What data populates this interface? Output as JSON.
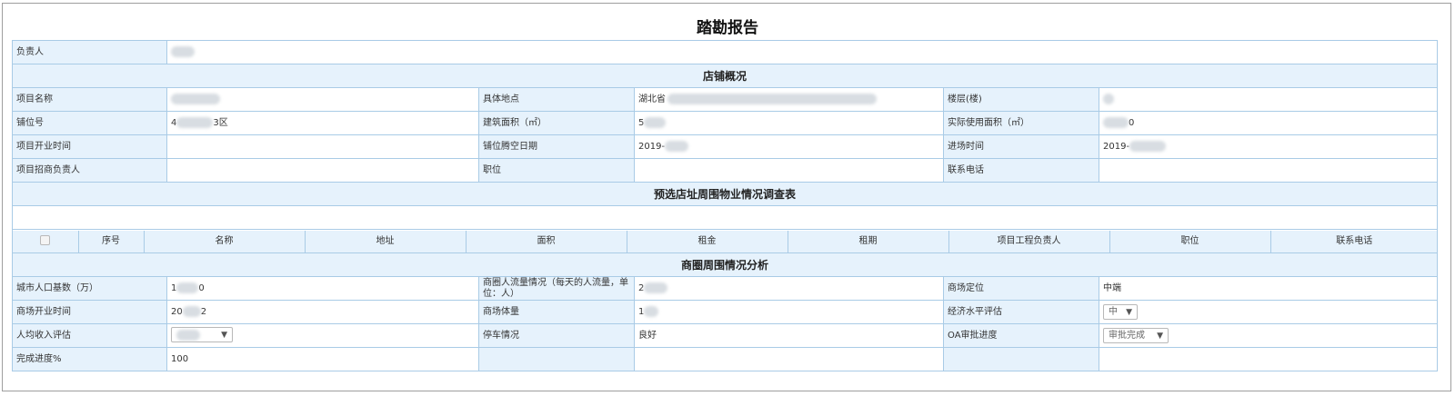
{
  "title": "踏勘报告",
  "owner": {
    "label": "负责人",
    "value": ""
  },
  "store_section": {
    "title": "店铺概况",
    "rows": [
      [
        {
          "label": "项目名称",
          "value": ""
        },
        {
          "label": "具体地点",
          "value": "湖北省"
        },
        {
          "label": "楼层(楼)",
          "value": ""
        }
      ],
      [
        {
          "label": "铺位号",
          "value": "4"
        },
        {
          "label": "建筑面积（㎡）",
          "value": "5"
        },
        {
          "label": "实际使用面积（㎡）",
          "value": "0"
        }
      ],
      [
        {
          "label": "项目开业时间",
          "value": ""
        },
        {
          "label": "铺位腾空日期",
          "value": "2019-"
        },
        {
          "label": "进场时间",
          "value": "2019-"
        }
      ],
      [
        {
          "label": "项目招商负责人",
          "value": ""
        },
        {
          "label": "职位",
          "value": ""
        },
        {
          "label": "联系电话",
          "value": ""
        }
      ]
    ],
    "shop_no_suffix": "3区"
  },
  "survey_section": {
    "title": "预选店址周围物业情况调查表",
    "columns": [
      "序号",
      "名称",
      "地址",
      "面积",
      "租金",
      "租期",
      "项目工程负责人",
      "职位",
      "联系电话"
    ]
  },
  "analysis_section": {
    "title": "商圈周围情况分析",
    "population": {
      "label": "城市人口基数（万）",
      "prefix": "1",
      "suffix": "0"
    },
    "flow": {
      "label": "商圈人流量情况（每天的人流量，单位：人）",
      "value": "2"
    },
    "positioning": {
      "label": "商场定位",
      "value": "中端"
    },
    "mall_open": {
      "label": "商场开业时间",
      "prefix": "20",
      "suffix": "2"
    },
    "mall_volume": {
      "label": "商场体量",
      "value": "1"
    },
    "economy": {
      "label": "经济水平评估",
      "value": "中"
    },
    "income": {
      "label": "人均收入评估",
      "value": ""
    },
    "parking": {
      "label": "停车情况",
      "value": "良好"
    },
    "oa": {
      "label": "OA审批进度",
      "value": "审批完成"
    },
    "progress": {
      "label": "完成进度%",
      "value": "100"
    }
  },
  "icons": {
    "dropdown": "chevron-down-icon",
    "checkbox": "checkbox-icon"
  },
  "colors": {
    "label_bg": "#e6f2fc",
    "border": "#a9cbe6"
  }
}
